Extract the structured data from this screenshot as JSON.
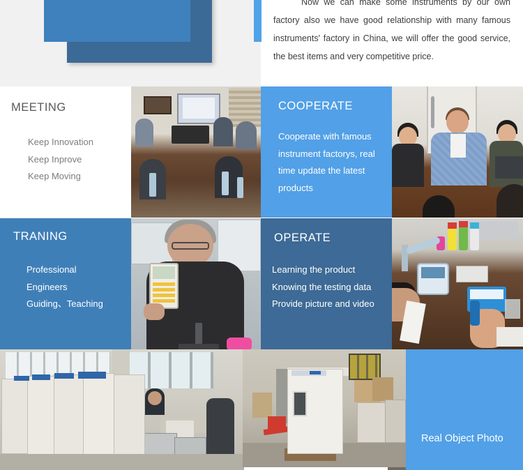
{
  "intro": {
    "paragraph": "Now we can make some instruments by our own factory also we have good relationship with many famous instruments' factory in China, we will offer the good service, the best items and very competitive price."
  },
  "sections": [
    {
      "id": "meeting",
      "title": "MEETING",
      "lines": [
        "Keep Innovation",
        "Keep Inprove",
        "Keep Moving"
      ],
      "bg": "#ffffff",
      "title_color": "#58595b",
      "text_color": "#7d7d7d",
      "photo_caption": "conference-room-meeting-photo"
    },
    {
      "id": "cooperate",
      "title": "COOPERATE",
      "lines": [
        "Cooperate with famous instrument factorys, real time update the latest products"
      ],
      "bg": "#52a0e7",
      "title_color": "#ffffff",
      "text_color": "#ffffff",
      "photo_caption": "foreign-client-discussion-photo"
    },
    {
      "id": "traning",
      "title": "TRANING",
      "lines": [
        "Professional",
        "Engineers",
        "Guiding、Teaching"
      ],
      "bg": "#3f7fb8",
      "title_color": "#ffffff",
      "text_color": "#ffffff",
      "photo_caption": "engineer-demonstrating-handheld-instrument-photo"
    },
    {
      "id": "operate",
      "title": "OPERATE",
      "lines": [
        "Learning the product",
        "Knowing the testing data",
        "Provide picture and video"
      ],
      "bg": "#3d6a96",
      "title_color": "#ffffff",
      "text_color": "#ffffff",
      "photo_caption": "laboratory-testing-bench-photo"
    }
  ],
  "real_object": {
    "label": "Real Object Photo",
    "bg": "#52a0e7",
    "photos": [
      "warehouse-row-of-incubator-cabinets-photo",
      "drying-oven-on-pallet-in-workshop-photo"
    ]
  },
  "colors": {
    "light_blue": "#52a0e7",
    "mid_blue": "#3f7fb8",
    "dark_blue": "#3d6a96",
    "page_grey": "#f1f1f1",
    "body_text": "#3d3d3d"
  }
}
